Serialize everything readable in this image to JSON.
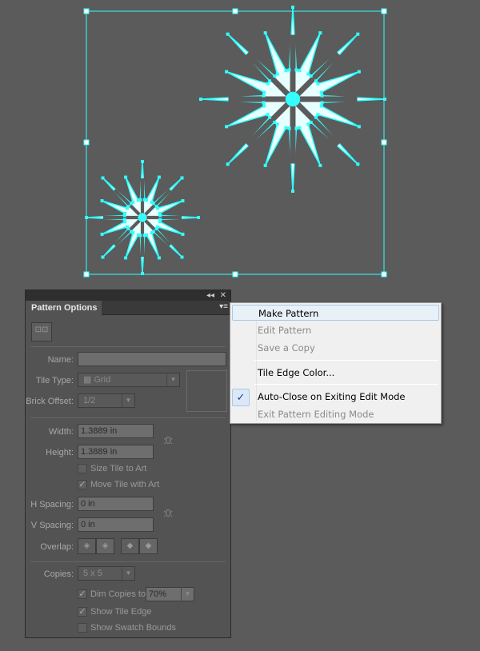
{
  "artboard": {
    "accent": "#33ffff",
    "background": "#5b5b5b"
  },
  "panel": {
    "tab_label": "Pattern Options",
    "collapse_icon": "double-chevron-left-icon",
    "close_icon": "close-icon",
    "tile_tool_icon": "pattern-tile-tool-icon",
    "name_label": "Name:",
    "name_value": "",
    "tile_type_label": "Tile Type:",
    "tile_type_value": "Grid",
    "brick_offset_label": "Brick Offset:",
    "brick_offset_value": "1/2",
    "width_label": "Width:",
    "width_value": "1.3889 in",
    "height_label": "Height:",
    "height_value": "1.3889 in",
    "size_tile_to_art": {
      "label": "Size Tile to Art",
      "checked": false
    },
    "move_tile_with_art": {
      "label": "Move Tile with Art",
      "checked": true
    },
    "h_spacing_label": "H Spacing:",
    "h_spacing_value": "0 in",
    "v_spacing_label": "V Spacing:",
    "v_spacing_value": "0 in",
    "overlap_label": "Overlap:",
    "copies_label": "Copies:",
    "copies_value": "5 x 5",
    "dim_copies": {
      "label": "Dim Copies to:",
      "checked": true,
      "value": "70%"
    },
    "show_tile_edge": {
      "label": "Show Tile Edge",
      "checked": true
    },
    "show_swatch_bounds": {
      "label": "Show Swatch Bounds",
      "checked": false
    }
  },
  "menu": {
    "items": [
      {
        "label": "Make Pattern",
        "enabled": true,
        "highlighted": true
      },
      {
        "label": "Edit Pattern",
        "enabled": false
      },
      {
        "label": "Save a Copy",
        "enabled": false
      },
      {
        "label": "Tile Edge Color...",
        "enabled": true
      },
      {
        "label": "Auto-Close on Exiting Edit Mode",
        "enabled": true,
        "checked": true
      },
      {
        "label": "Exit Pattern Editing Mode",
        "enabled": false
      }
    ]
  }
}
